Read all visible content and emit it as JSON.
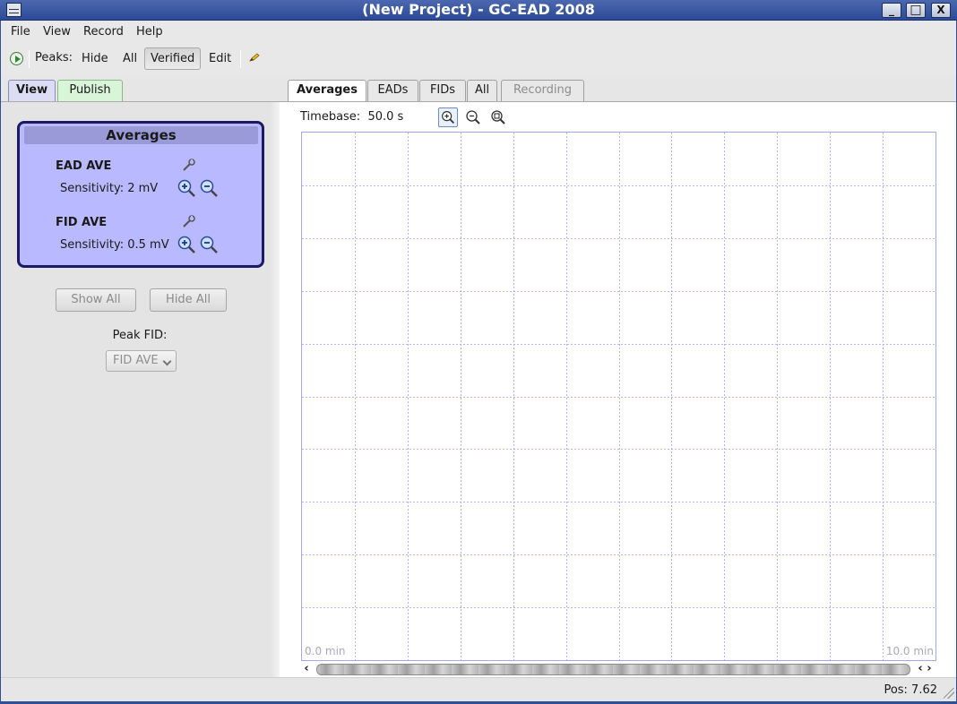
{
  "window": {
    "title": "(New Project) - GC-EAD 2008",
    "minimize": "_",
    "maximize": "□",
    "close": "X"
  },
  "menu": {
    "file": "File",
    "view": "View",
    "record": "Record",
    "help": "Help"
  },
  "toolbar": {
    "peaks_label": "Peaks:",
    "hide": "Hide",
    "all": "All",
    "verified": "Verified",
    "edit": "Edit",
    "active_filter": "Verified"
  },
  "left_tabs": {
    "view": "View",
    "publish": "Publish",
    "active": "View"
  },
  "averages": {
    "heading": "Averages",
    "traces": [
      {
        "name": "EAD AVE",
        "sensitivity": "Sensitivity: 2 mV"
      },
      {
        "name": "FID AVE",
        "sensitivity": "Sensitivity: 0.5 mV"
      }
    ]
  },
  "left_buttons": {
    "show_all": "Show All",
    "hide_all": "Hide All"
  },
  "peak_fid": {
    "label": "Peak FID:",
    "selected": "FID AVE"
  },
  "right_tabs": {
    "averages": "Averages",
    "eads": "EADs",
    "fids": "FIDs",
    "all": "All",
    "recording": "Recording",
    "active": "Averages"
  },
  "plot": {
    "timebase_label": "Timebase:",
    "timebase_value": "50.0 s",
    "x_start_label": "0.0 min",
    "x_end_label": "10.0 min",
    "grid": true,
    "grid_color": "#b4b4ee"
  },
  "scrollbar": {
    "left_arrow": "‹",
    "right_arrows": "‹ ›"
  },
  "status": {
    "position": "Pos: 7.62"
  }
}
